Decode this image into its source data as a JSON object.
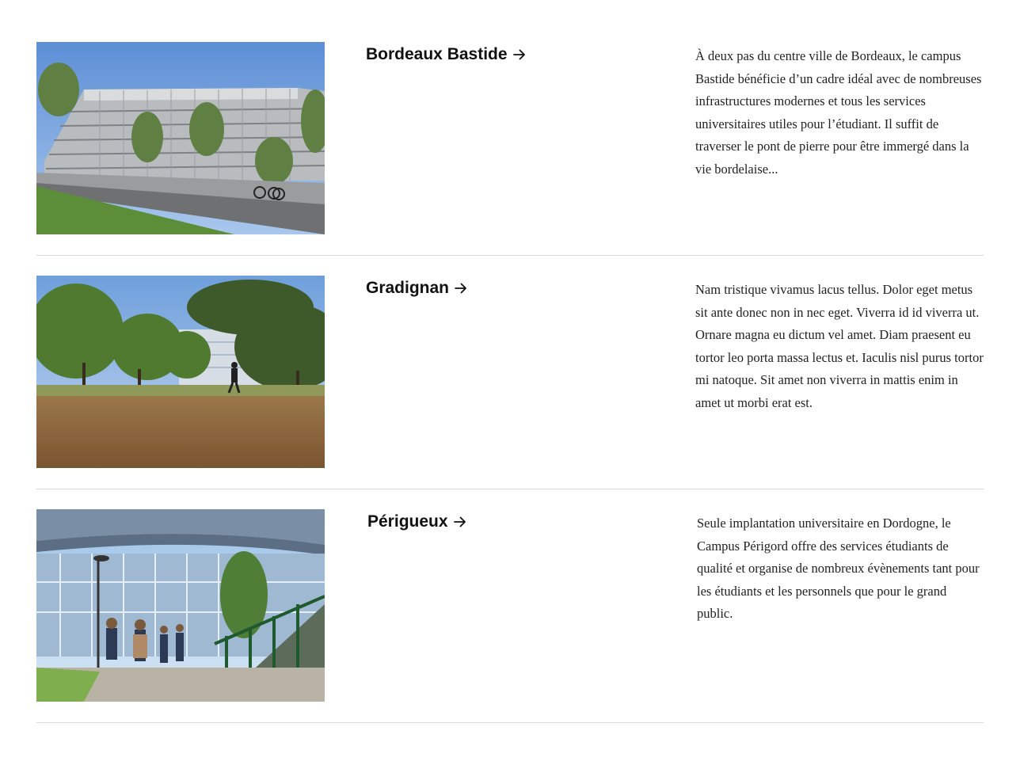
{
  "campuses": [
    {
      "name": "Bordeaux Bastide",
      "photo": "bastide-campus-building-photo",
      "description": "À deux pas du centre ville de Bordeaux, le campus Bastide bénéficie d’un cadre idéal avec de nombreuses infrastructures modernes et tous les services universitaires utiles pour l’étudiant. Il suffit de traverser le pont de pierre pour être immergé dans la vie bordelaise..."
    },
    {
      "name": "Gradignan",
      "photo": "gradignan-campus-park-photo",
      "description": "Nam tristique vivamus lacus tellus. Dolor eget metus sit ante donec non in nec eget. Viverra id id viverra ut. Ornare magna eu dictum vel amet. Diam praesent eu tortor leo porta massa lectus et. Iaculis nisl purus tortor mi natoque. Sit amet non viverra in mattis enim in amet ut morbi erat est."
    },
    {
      "name": "Périgueux",
      "photo": "perigueux-campus-students-photo",
      "description": "Seule implantation universitaire en Dordogne, le Campus Périgord offre des services étudiants de qualité et organise de nombreux évènements tant pour les étudiants et les personnels que pour le grand public."
    }
  ],
  "icons": {
    "link_arrow": "arrow-right-icon"
  }
}
